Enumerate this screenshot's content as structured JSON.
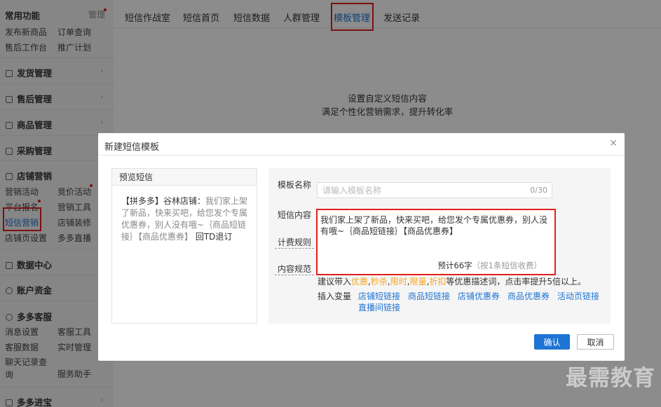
{
  "sidebar": {
    "common_title": "常用功能",
    "manage_label": "管理",
    "common_links": [
      "发布新商品",
      "订单查询",
      "售后工作台",
      "推广计划"
    ],
    "menus": {
      "shipping": "发货管理",
      "aftersale": "售后管理",
      "goods": "商品管理",
      "purchase": "采购管理",
      "marketing": "店铺营销",
      "data": "数据中心",
      "funds": "账户资金",
      "service": "多多客服",
      "jinbao": "多多进宝"
    },
    "marketing_links": [
      "营销活动",
      "竞价活动",
      "平台报名",
      "营销工具",
      "短信营销",
      "店铺装修",
      "店铺页设置",
      "多多直播"
    ],
    "service_links": [
      "消息设置",
      "客服工具",
      "客服数据",
      "实时管理",
      "聊天记录查询",
      "服务助手"
    ]
  },
  "tabs": [
    "短信作战室",
    "短信首页",
    "短信数据",
    "人群管理",
    "模板管理",
    "发送记录"
  ],
  "active_tab": "模板管理",
  "background": {
    "line1": "设置自定义短信内容",
    "line2": "满足个性化营销需求，提升转化率"
  },
  "dialog": {
    "title": "新建短信模板",
    "close_icon": "close-icon",
    "preview": {
      "title": "预览短信",
      "shop_prefix": "【拼多多】谷林店铺：",
      "body": "我们家上架了新品，快来买吧，给您发个专属优惠券，别人没有哦~｛商品短链接｝【商品优惠券】",
      "suffix": "回TD退订"
    },
    "form": {
      "name_label": "模板名称",
      "name_placeholder": "请输入模板名称",
      "name_count": "0/30",
      "content_label": "短信内容",
      "billing_label": "计费规则",
      "spec_label": "内容规范",
      "content_value": "我们家上架了新品，快来买吧，给您发个专属优惠券，别人没有哦~｛商品短链接｝【商品优惠券】",
      "estimate_main": "预计66字",
      "estimate_note": "（按1条短信收费）",
      "suggest_prefix": "建议带入",
      "suggest_words": [
        "优惠",
        "秒杀",
        "限时",
        "限量",
        "折扣"
      ],
      "suggest_suffix": "等优惠描述词，点击率提升5倍以上。",
      "vars_label": "插入变量",
      "vars": [
        "店铺短链接",
        "商品短链接",
        "店铺优惠券",
        "商品优惠券",
        "活动页链接",
        "直播间链接"
      ]
    },
    "ok_label": "确认",
    "cancel_label": "取消"
  },
  "watermark": "最需教育",
  "colors": {
    "accent": "#1e74d4",
    "highlight_border": "#e02020",
    "suggest_word": "#f5a623"
  }
}
